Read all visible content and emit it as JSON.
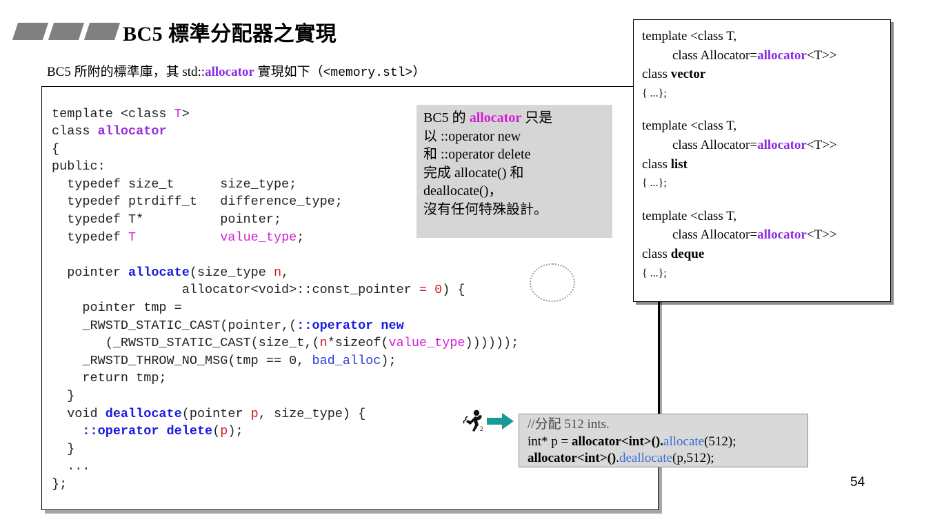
{
  "slide": {
    "title": "BC5 標準分配器之實現",
    "subtitle_parts": {
      "p1": "BC5 所附的標準庫，其 std::",
      "allocator": "allocator",
      "p2": " 實現如下（",
      "header": "<memory.stl>",
      "p3": "）"
    },
    "page_number": "54",
    "bullet_icon": "parallelogram-bullets"
  },
  "code_block": {
    "language": "cpp",
    "lines": [
      "template <class T>",
      "class allocator",
      "{",
      "public:",
      "  typedef size_t      size_type;",
      "  typedef ptrdiff_t   difference_type;",
      "  typedef T*          pointer;",
      "  typedef T           value_type;",
      "",
      "  pointer allocate(size_type n,",
      "                 allocator<void>::const_pointer = 0) {",
      "    pointer tmp =",
      "    _RWSTD_STATIC_CAST(pointer,(::operator new",
      "       (_RWSTD_STATIC_CAST(size_t,(n*sizeof(value_type))))));",
      "    _RWSTD_THROW_NO_MSG(tmp == 0, bad_alloc);",
      "    return tmp;",
      "  }",
      "  void deallocate(pointer p, size_type) {",
      "    ::operator delete(p);",
      "  }",
      "  ...",
      "};"
    ],
    "highlight_colors": {
      "type_param": "#d21fd2",
      "class_name": "#9a2ede",
      "function": "#1a1ae0",
      "keyword_operator": "#1a1ae0",
      "identifier": "#d02020",
      "exception": "#2b3fd0"
    },
    "annotation": "dotted-ellipse-around-default-argument"
  },
  "callout_note": {
    "background": "#d6d6d6",
    "lines": [
      {
        "pre": "BC5 的 ",
        "highlight": "allocator",
        "post": " 只是"
      },
      {
        "pre": "以 ::operator new",
        "highlight": "",
        "post": ""
      },
      {
        "pre": "和 ::operator delete",
        "highlight": "",
        "post": ""
      },
      {
        "pre": "完成 allocate() 和",
        "highlight": "",
        "post": ""
      },
      {
        "pre": "deallocate()，",
        "highlight": "",
        "post": ""
      },
      {
        "pre": "沒有任何特殊設計。",
        "highlight": "",
        "post": ""
      }
    ]
  },
  "containers_box": {
    "blocks": [
      {
        "l1": "template <class T,",
        "l2_pre": "class Allocator=",
        "l2_alloc": "allocator",
        "l2_post": "<T>>",
        "l3_pre": "class ",
        "l3_name": "vector",
        "l4": "{ ...};"
      },
      {
        "l1": "template <class T,",
        "l2_pre": "class Allocator=",
        "l2_alloc": "allocator",
        "l2_post": "<T>>",
        "l3_pre": "class ",
        "l3_name": "list",
        "l4": "{ ...};"
      },
      {
        "l1": "template <class T,",
        "l2_pre": "class Allocator=",
        "l2_alloc": "allocator",
        "l2_post": "<T>>",
        "l3_pre": "class ",
        "l3_name": "deque",
        "l4": "{ ...};"
      }
    ],
    "allocator_color": "#8a2be2"
  },
  "usage_box": {
    "background": "#d9d9d9",
    "comment": "//分配 512 ints.",
    "line2": {
      "p1": "int* p = ",
      "p2": "allocator<int>()",
      "p3": ".",
      "p4": "allocate",
      "p5": "(512);"
    },
    "line3": {
      "p2": "allocator<int>()",
      "p3": ".",
      "p4": "deallocate",
      "p5": "(p,512);"
    },
    "method_color": "#3b6fd4"
  },
  "icons": {
    "runner": "running-person-icon",
    "arrow": "right-arrow-icon",
    "arrow_color": "#1a9a96"
  }
}
